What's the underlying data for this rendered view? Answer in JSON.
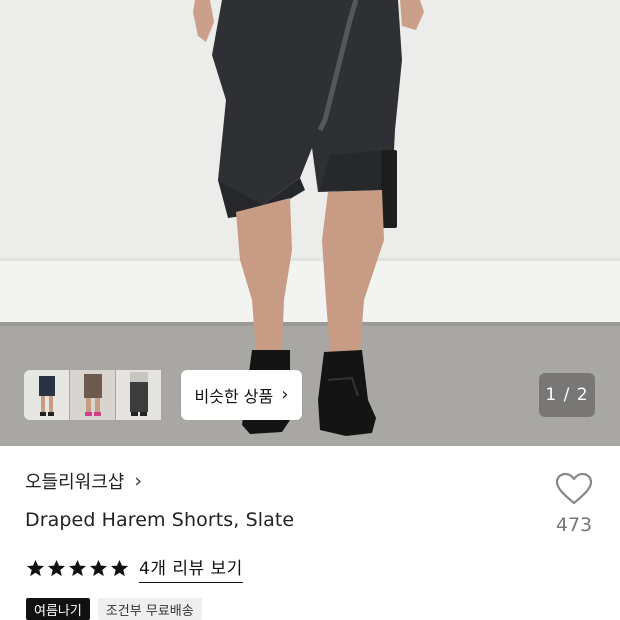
{
  "gallery": {
    "page_indicator": "1 / 2",
    "similar_products_label": "비슷한 상품",
    "thumbnails": [
      "similar-item-1",
      "similar-item-2",
      "similar-item-3"
    ]
  },
  "product": {
    "shop_name": "오들리워크샵",
    "title": "Draped Harem Shorts, Slate",
    "like_count": "473",
    "rating": 5,
    "review_link": "4개 리뷰 보기",
    "tags": [
      "여름나기",
      "조건부 무료배송"
    ]
  },
  "colors": {
    "star": "#111111",
    "tag_dark_bg": "#111111",
    "tag_light_bg": "#efefef",
    "like_count": "#777777"
  }
}
